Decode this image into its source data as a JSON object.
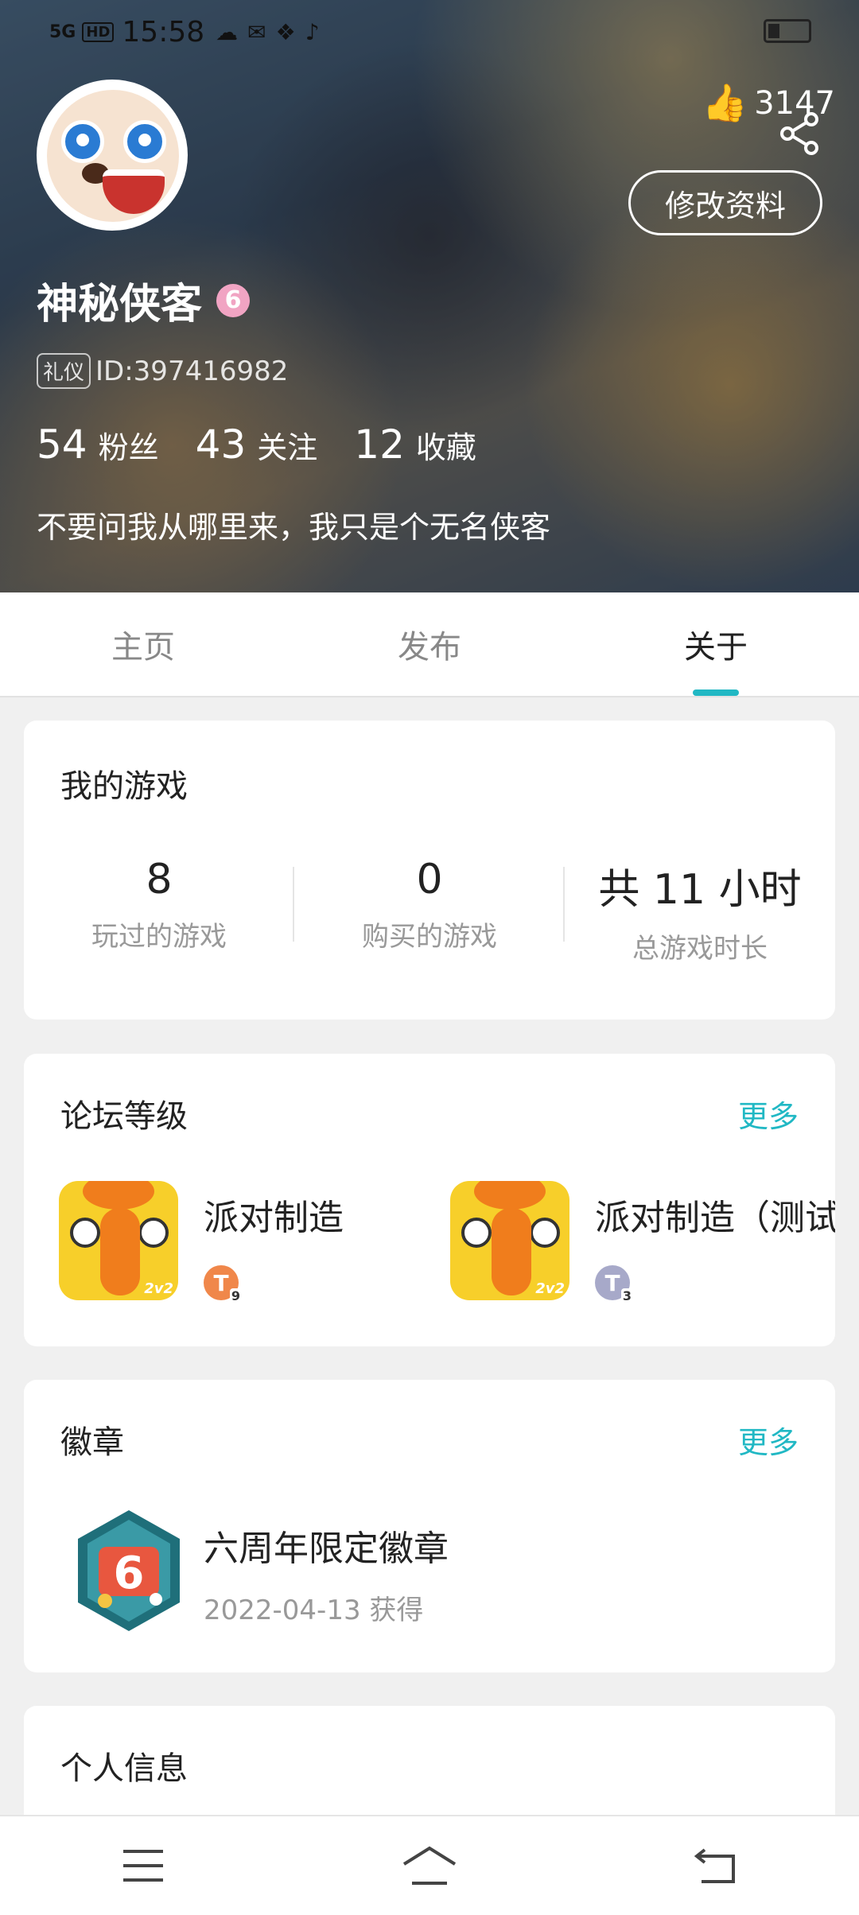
{
  "status_bar": {
    "signal": "5G",
    "hd": "HD",
    "time": "15:58"
  },
  "profile": {
    "likes": "3147",
    "edit_label": "修改资料",
    "nickname": "神秘侠客",
    "level_badge": "6",
    "id_tag": "礼仪",
    "id_text": "ID:397416982",
    "stats": [
      {
        "num": "54",
        "label": "粉丝"
      },
      {
        "num": "43",
        "label": "关注"
      },
      {
        "num": "12",
        "label": "收藏"
      }
    ],
    "bio": "不要问我从哪里来，我只是个无名侠客"
  },
  "tabs": [
    "主页",
    "发布",
    "关于"
  ],
  "active_tab": "关于",
  "my_games": {
    "title": "我的游戏",
    "stats": [
      {
        "value": "8",
        "label": "玩过的游戏"
      },
      {
        "value": "0",
        "label": "购买的游戏"
      },
      {
        "value": "共 11 小时",
        "label": "总游戏时长"
      }
    ]
  },
  "forum": {
    "title": "论坛等级",
    "more": "更多",
    "items": [
      {
        "name": "派对制造",
        "rank": "T",
        "rank_level": "9",
        "icon_tag": "2v2"
      },
      {
        "name": "派对制造（测试",
        "rank": "T",
        "rank_level": "3",
        "icon_tag": "2v2"
      }
    ]
  },
  "badges": {
    "title": "徽章",
    "more": "更多",
    "item": {
      "name": "六周年限定徽章",
      "date": "2022-04-13 获得"
    }
  },
  "personal": {
    "title": "个人信息"
  },
  "colors": {
    "accent": "#21b8c4"
  }
}
